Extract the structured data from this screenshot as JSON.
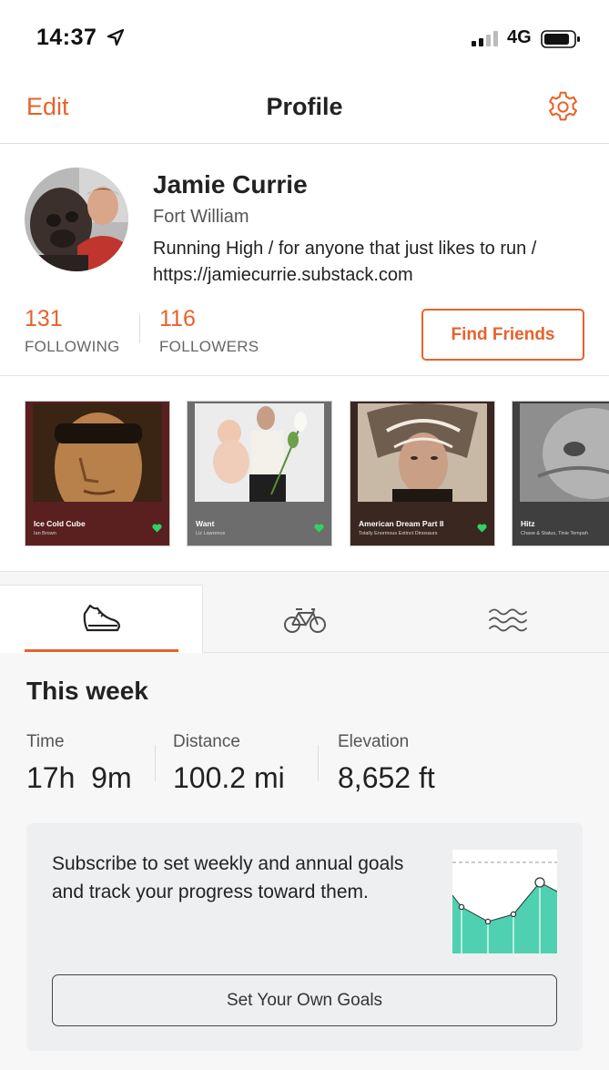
{
  "status_bar": {
    "time": "14:37",
    "network": "4G",
    "icons": [
      "location-arrow-icon",
      "signal-icon",
      "battery-icon"
    ]
  },
  "nav": {
    "edit_label": "Edit",
    "title": "Profile",
    "settings_icon": "gear-icon"
  },
  "profile": {
    "name": "Jamie Currie",
    "location": "Fort William",
    "bio": "Running High / for anyone that just likes to run / https://jamiecurrie.substack.com",
    "following_count": "131",
    "following_label": "FOLLOWING",
    "followers_count": "116",
    "followers_label": "FOLLOWERS",
    "find_friends_label": "Find Friends"
  },
  "music": [
    {
      "title": "Ice Cold Cube",
      "artist": "Ian Brown",
      "liked": true
    },
    {
      "title": "Want",
      "artist": "Liz Lawrence",
      "liked": true
    },
    {
      "title": "American Dream Part II",
      "artist": "Totally Enormous Extinct Dinosaurs",
      "liked": true
    },
    {
      "title": "Hitz",
      "artist": "Chase & Status, Tinie Tempah",
      "liked": false
    }
  ],
  "activity_tabs": [
    {
      "icon": "running-shoe-icon",
      "active": true
    },
    {
      "icon": "bicycle-icon",
      "active": false
    },
    {
      "icon": "swim-waves-icon",
      "active": false
    }
  ],
  "this_week": {
    "title": "This week",
    "time_label": "Time",
    "time_value": "17h  9m",
    "distance_label": "Distance",
    "distance_value": "100.2 mi",
    "elevation_label": "Elevation",
    "elevation_value": "8,652 ft"
  },
  "goals": {
    "text": "Subscribe to set weekly and annual goals and track your progress toward them.",
    "button_label": "Set Your Own Goals"
  },
  "colors": {
    "accent": "#e8622a",
    "chart_fill": "#4fd0b0",
    "heart": "#2fd16a"
  }
}
